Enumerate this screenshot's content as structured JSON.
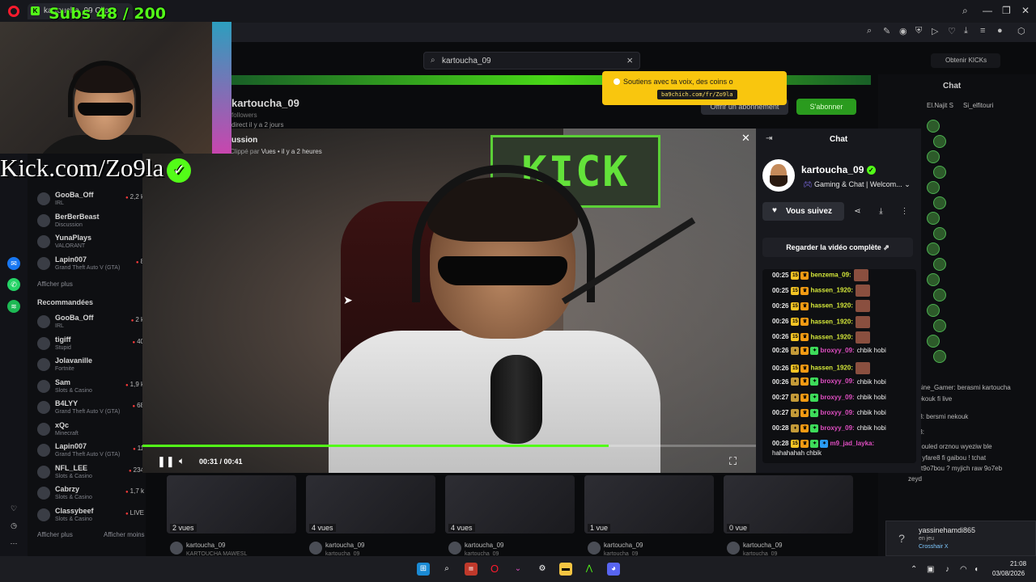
{
  "browser": {
    "tab_title": "kartoucha_09 Clip",
    "tab_favicon": "K",
    "window_controls": {
      "minimize": "—",
      "maximize": "❐",
      "close": "✕"
    }
  },
  "sidebar_left": {
    "followed": [
      {
        "name": "GooBa_Off",
        "category": "IRL",
        "viewers": "2,2 k"
      },
      {
        "name": "BerBerBeast",
        "category": "Discussion",
        "viewers": ""
      },
      {
        "name": "YunaPlays",
        "category": "VALORANT",
        "viewers": ""
      },
      {
        "name": "Lapin007",
        "category": "Grand Theft Auto V (GTA)",
        "viewers": "8"
      }
    ],
    "show_more_1": "Afficher plus",
    "recommended_heading": "Recommandées",
    "recommended": [
      {
        "name": "GooBa_Off",
        "category": "IRL",
        "viewers": "2 k"
      },
      {
        "name": "tigiff",
        "category": "Stupid",
        "viewers": "40"
      },
      {
        "name": "Jolavanille",
        "category": "Fortnite",
        "viewers": ""
      },
      {
        "name": "Sam",
        "category": "Slots & Casino",
        "viewers": "1,9 k"
      },
      {
        "name": "B4LYY",
        "category": "Grand Theft Auto V (GTA)",
        "viewers": "68"
      },
      {
        "name": "xQc",
        "category": "Minecraft",
        "viewers": ""
      },
      {
        "name": "Lapin007",
        "category": "Grand Theft Auto V (GTA)",
        "viewers": "11"
      },
      {
        "name": "NFL_LEE",
        "category": "Slots & Casino",
        "viewers": "234"
      },
      {
        "name": "Cabrzy",
        "category": "Slots & Casino",
        "viewers": "1,7 k"
      },
      {
        "name": "Classybeef",
        "category": "Slots & Casino",
        "viewers": "LIVE"
      }
    ],
    "show_more_2": "Afficher plus",
    "show_less": "Afficher moins"
  },
  "search": {
    "value": "kartoucha_09"
  },
  "kicks_button": "Obtenir KICKs",
  "background_channel": {
    "name": "kartoucha_09",
    "followers": "followers",
    "live_info": "direct il y a 2 jours",
    "subscribe_label": "Offrir un abonnement",
    "follow_label": "S'abonner"
  },
  "background_chat": {
    "title": "Chat",
    "pinned": [
      "El.Najit S",
      "Si_elfitouri"
    ],
    "lines": [
      "hassine_Gamer: berasmi kartoucha",
      "ci nekouk fi live",
      "_b13: bersmi nekouk",
      "_b13:",
      "N1: iouled orznou wyeziw ble",
      "kom yfare8 fi gaibou ! tchat",
      "ru fet9o7bou ? myjich raw 9o7eb",
      "zeyd"
    ]
  },
  "toast": {
    "message": "Soutiens avec ta voix, des coins o",
    "link": "ba9chich.com/fr/Zo9la"
  },
  "video": {
    "category_text": "ussion",
    "meta_text": "Vues • il y a 2 heures",
    "clipped_by": "Clippé par",
    "current_time": "00:31",
    "duration": "00:41",
    "time_display": "00:31 / 00:41",
    "progress": 0.76,
    "sign_text": "KICK"
  },
  "modal_chat": {
    "title": "Chat",
    "channel_name": "kartoucha_09",
    "stream_title": "Gaming & Chat | Welcom...",
    "follow_label": "Vous suivez",
    "watch_full": "Regarder la vidéo complète",
    "messages": [
      {
        "time": "00:25",
        "user": "benzema_09:",
        "badges": [
          "sub",
          "crown"
        ],
        "text": "",
        "emote": true,
        "color": "yellow"
      },
      {
        "time": "00:25",
        "user": "hassen_1920:",
        "badges": [
          "sub",
          "crown"
        ],
        "text": "",
        "emote": true,
        "color": "yellow"
      },
      {
        "time": "00:26",
        "user": "hassen_1920:",
        "badges": [
          "sub",
          "crown"
        ],
        "text": "",
        "emote": true,
        "color": "yellow"
      },
      {
        "time": "00:26",
        "user": "hassen_1920:",
        "badges": [
          "sub",
          "crown"
        ],
        "text": "",
        "emote": true,
        "color": "yellow"
      },
      {
        "time": "00:26",
        "user": "hassen_1920:",
        "badges": [
          "sub",
          "crown"
        ],
        "text": "",
        "emote": true,
        "color": "yellow"
      },
      {
        "time": "00:26",
        "user": "broxyy_09:",
        "badges": [
          "gift",
          "crown",
          "star"
        ],
        "text": "chbik hobi",
        "emote": false,
        "color": "pink"
      },
      {
        "time": "00:26",
        "user": "hassen_1920:",
        "badges": [
          "sub",
          "crown"
        ],
        "text": "",
        "emote": true,
        "color": "yellow"
      },
      {
        "time": "00:26",
        "user": "broxyy_09:",
        "badges": [
          "gift",
          "crown",
          "star"
        ],
        "text": "chbik hobi",
        "emote": false,
        "color": "pink"
      },
      {
        "time": "00:27",
        "user": "broxyy_09:",
        "badges": [
          "gift",
          "crown",
          "star"
        ],
        "text": "chbik hobi",
        "emote": false,
        "color": "pink"
      },
      {
        "time": "00:27",
        "user": "broxyy_09:",
        "badges": [
          "gift",
          "crown",
          "star"
        ],
        "text": "chbik hobi",
        "emote": false,
        "color": "pink"
      },
      {
        "time": "00:28",
        "user": "broxyy_09:",
        "badges": [
          "gift",
          "crown",
          "star"
        ],
        "text": "chbik hobi",
        "emote": false,
        "color": "pink"
      },
      {
        "time": "00:28",
        "user": "m9_jad_layka:",
        "badges": [
          "sub",
          "crown",
          "star",
          "blue"
        ],
        "text": "",
        "emote": false,
        "color": "pink"
      }
    ],
    "last_message_wrap": "hahahahah chbik"
  },
  "related_videos": [
    {
      "views": "2 vues",
      "channel": "kartoucha_09",
      "title": "KARTOUCHA MAWESL"
    },
    {
      "views": "4 vues",
      "channel": "kartoucha_09",
      "title": "kartoucha_09"
    },
    {
      "views": "4 vues",
      "channel": "kartoucha_09",
      "title": "kartoucha_09"
    },
    {
      "views": "1 vue",
      "channel": "kartoucha_09",
      "title": "kartoucha_09"
    },
    {
      "views": "0 vue",
      "channel": "kartoucha_09",
      "title": "kartoucha_09"
    }
  ],
  "overlay": {
    "subs_goal": "Subs 48 / 200",
    "kick_url": "Kick.com/Zo9la"
  },
  "notification": {
    "user": "yassinehamdi865",
    "state": "en jeu",
    "game": "Crosshair X"
  },
  "taskbar": {
    "time": "21:08",
    "date": "03/08/2026"
  },
  "colors": {
    "kick_green": "#53fc18",
    "toast_yellow": "#f9c60e",
    "opera_red": "#ff1b2d"
  }
}
